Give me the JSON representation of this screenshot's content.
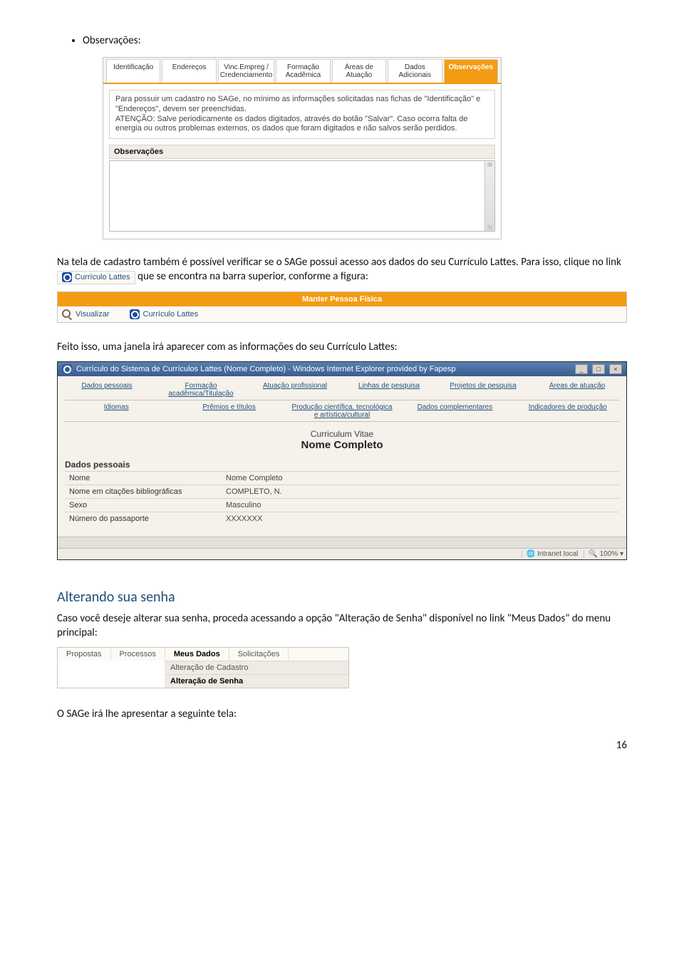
{
  "heading_bullet": "Observações:",
  "shot1": {
    "tabs": [
      "Identificação",
      "Endereços",
      "Vinc.Empreg / Credenciamento",
      "Formação Acadêmica",
      "Áreas de Atuação",
      "Dados Adicionais",
      "Observações"
    ],
    "active_tab_index": 6,
    "info_text": "Para possuir um cadastro no SAGe, no mínimo as informações solicitadas nas fichas de \"Identificação\" e \"Endereços\", devem ser preenchidas.\nATENÇÃO: Salve periodicamente os dados digitados, através do botão \"Salvar\". Caso ocorra falta de energia ou outros problemas externos, os dados que foram digitados e não salvos serão perdidos.",
    "section_title": "Observações"
  },
  "para1_before": "Na tela de cadastro também é possível verificar se o SAGe possui acesso aos dados do seu Currículo Lattes. Para isso, clique no link ",
  "inline_link_label": "Currículo Lattes",
  "para1_after": " que se encontra na barra superior, conforme a figura:",
  "shot2": {
    "title": "Manter Pessoa Física",
    "visualizar": "Visualizar",
    "curriculo": "Currículo Lattes"
  },
  "para2": "Feito isso, uma janela irá aparecer com as informações do seu Currículo Lattes:",
  "shot3": {
    "window_title": "Currículo do Sistema de Currículos Lattes (Nome Completo) - Windows Internet Explorer provided by Fapesp",
    "tabs_row1": [
      "Dados pessoais",
      "Formação acadêmica/Titulação",
      "Atuação profissional",
      "Linhas de pesquisa",
      "Projetos de pesquisa",
      "Áreas de atuação"
    ],
    "tabs_row2": [
      "Idiomas",
      "Prêmios e títulos",
      "Produção científica, tecnológica e artística/cultural",
      "Dados complementares",
      "Indicadores de produção"
    ],
    "cv_line1": "Curriculum Vitae",
    "cv_line2": "Nome Completo",
    "section": "Dados pessoais",
    "rows": [
      [
        "Nome",
        "Nome Completo"
      ],
      [
        "Nome em citações bibliográficas",
        "COMPLETO, N."
      ],
      [
        "Sexo",
        "Masculino"
      ],
      [
        "Número do passaporte",
        "XXXXXXX"
      ]
    ],
    "status_intranet": "Intranet local",
    "status_zoom": "100%"
  },
  "h2": "Alterando sua senha",
  "para3": "Caso você deseje alterar sua senha, proceda acessando a opção \"Alteração de Senha\" disponível no link \"Meus Dados\" do menu principal:",
  "shot4": {
    "menu": [
      "Propostas",
      "Processos",
      "Meus Dados",
      "Solicitações"
    ],
    "menu_active_index": 2,
    "submenu": [
      "Alteração de Cadastro",
      "Alteração de Senha"
    ],
    "submenu_active_index": 1
  },
  "para4": "O SAGe irá lhe apresentar a seguinte tela:",
  "page_number": "16"
}
